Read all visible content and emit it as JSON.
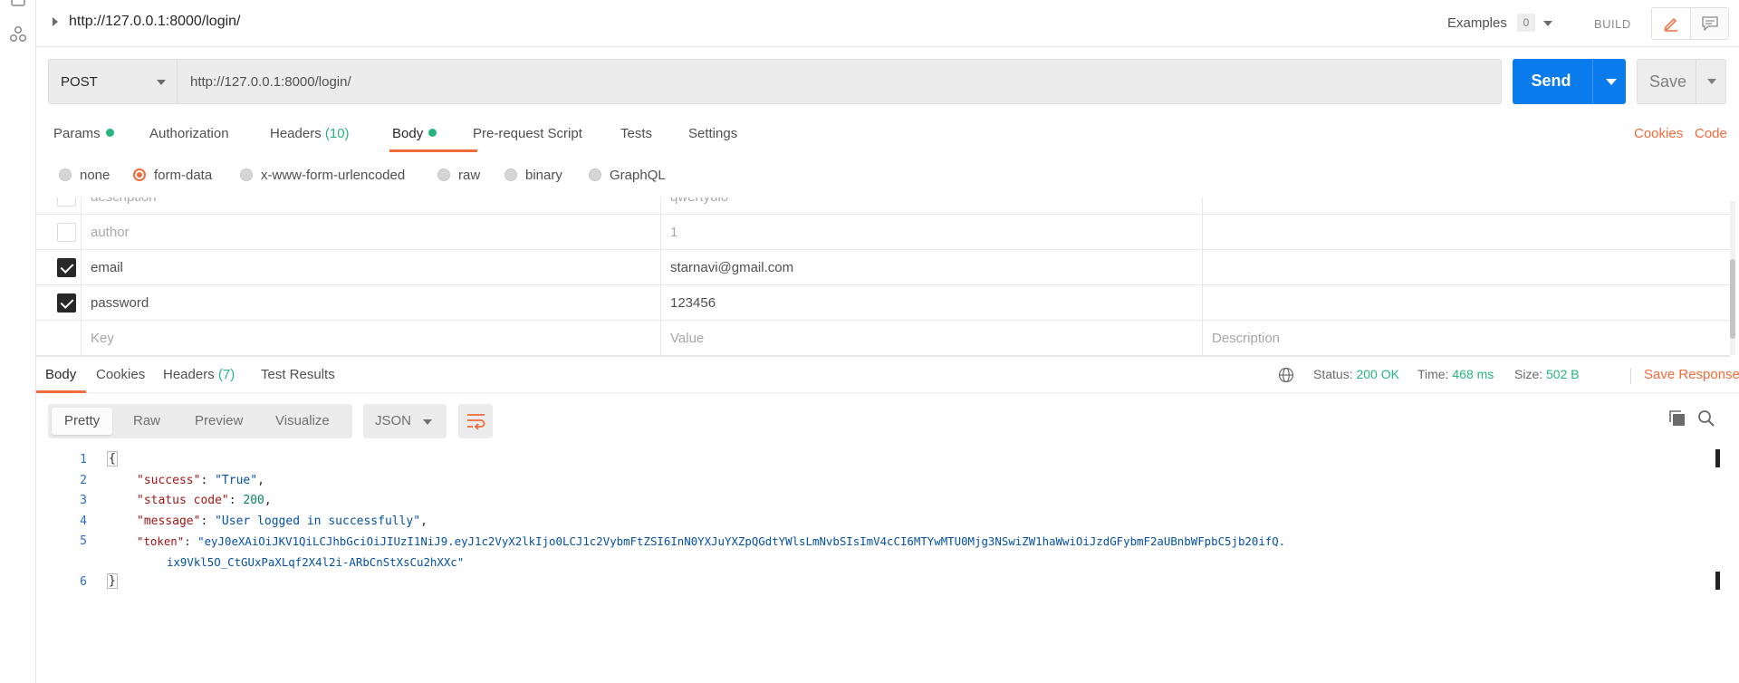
{
  "header": {
    "title": "http://127.0.0.1:8000/login/",
    "examples_label": "Examples",
    "examples_count": "0",
    "build_label": "BUILD"
  },
  "request": {
    "method": "POST",
    "url": "http://127.0.0.1:8000/login/",
    "send_label": "Send",
    "save_label": "Save"
  },
  "request_tabs": [
    {
      "label": "Params",
      "count": ""
    },
    {
      "label": "Authorization",
      "count": ""
    },
    {
      "label": "Headers",
      "count": "(10)"
    },
    {
      "label": "Body",
      "count": ""
    },
    {
      "label": "Pre-request Script",
      "count": ""
    },
    {
      "label": "Tests",
      "count": ""
    },
    {
      "label": "Settings",
      "count": ""
    }
  ],
  "right_links": {
    "cookies": "Cookies",
    "code": "Code"
  },
  "body_types": [
    "none",
    "form-data",
    "x-www-form-urlencoded",
    "raw",
    "binary",
    "GraphQL"
  ],
  "body_type_selected": "form-data",
  "form_rows": [
    {
      "key": "description",
      "value": "qwertyuio",
      "description": "",
      "checked": false
    },
    {
      "key": "author",
      "value": "1",
      "description": "",
      "checked": false
    },
    {
      "key": "email",
      "value": "starnavi@gmail.com",
      "description": "",
      "checked": true
    },
    {
      "key": "password",
      "value": "123456",
      "description": "",
      "checked": true
    }
  ],
  "form_placeholders": {
    "key": "Key",
    "value": "Value",
    "description": "Description"
  },
  "response_tabs": [
    {
      "label": "Body",
      "count": ""
    },
    {
      "label": "Cookies",
      "count": ""
    },
    {
      "label": "Headers",
      "count": "(7)"
    },
    {
      "label": "Test Results",
      "count": ""
    }
  ],
  "response_status": {
    "status_label": "Status:",
    "status_value": "200 OK",
    "time_label": "Time:",
    "time_value": "468 ms",
    "size_label": "Size:",
    "size_value": "502 B",
    "save_response": "Save Response"
  },
  "view_modes": [
    "Pretty",
    "Raw",
    "Preview",
    "Visualize"
  ],
  "format": "JSON",
  "code_lines": [
    {
      "n": "1",
      "key": "",
      "val": ""
    },
    {
      "n": "2",
      "key": "\"success\"",
      "val": "\"True\""
    },
    {
      "n": "3",
      "key": "\"status code\"",
      "val": "200"
    },
    {
      "n": "4",
      "key": "\"message\"",
      "val": "\"User logged in successfully\""
    },
    {
      "n": "5",
      "key": "\"token\"",
      "val": "\"eyJ0eXAiOiJKV1QiLCJhbGciOiJIUzI1NiJ9.eyJ1c2VyX2lkIjo0LCJ1c2VybmFtZSI6InN0YXJuYXZpQGdtYWlsLmNvbSIsImV4cCI6MTYwMTU0Mjg3NSwiZW1haWwiOiJzdGFybmF2aUBnbWFpbC5jb20ifQ."
    },
    {
      "n": "",
      "key": "",
      "val": "ix9Vkl5O_CtGUxPaXLqf2X4l2i-ARbCnStXsCu2hXXc\""
    },
    {
      "n": "6",
      "key": "",
      "val": ""
    }
  ],
  "colors": {
    "accent_orange": "#f26b3a",
    "send_blue": "#097bed",
    "success_green": "#26b47f"
  }
}
